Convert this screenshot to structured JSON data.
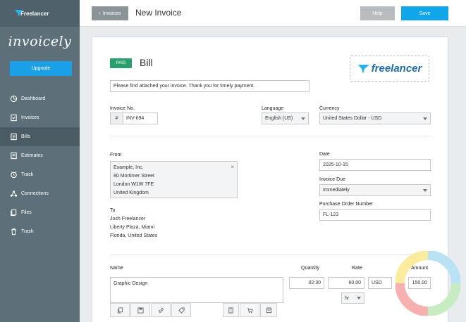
{
  "brand": {
    "name": "Freelancer"
  },
  "sidebar": {
    "logo": "invoicely",
    "upgrade_label": "Upgrade",
    "items": [
      {
        "label": "Dashboard",
        "icon": "dashboard-icon"
      },
      {
        "label": "Invoices",
        "icon": "invoice-icon"
      },
      {
        "label": "Bills",
        "icon": "bill-icon",
        "active": true
      },
      {
        "label": "Estimates",
        "icon": "estimate-icon"
      },
      {
        "label": "Track",
        "icon": "alarm-clock-icon"
      },
      {
        "label": "Connections",
        "icon": "connections-icon"
      },
      {
        "label": "Files",
        "icon": "files-icon"
      },
      {
        "label": "Trash",
        "icon": "trash-icon"
      }
    ]
  },
  "header": {
    "back_label": "Invoices",
    "title": "New Invoice",
    "help_label": "Help",
    "save_label": "Save"
  },
  "doc": {
    "status": "PAID",
    "type": "Bill",
    "logo_text": "freelancer",
    "message": "Please find attached your invoice. Thank you for timely payment.",
    "invoice_no_label": "Invoice No.",
    "invoice_prefix": "#",
    "invoice_no": "INV-694",
    "language_label": "Language",
    "language": "English (US)",
    "currency_label": "Currency",
    "currency": "United States Dollar - USD",
    "from_label": "From",
    "from_lines": [
      "Example, Inc.",
      "80 Mortimer Street",
      "London W1W 7FE",
      "United Kingdom"
    ],
    "to_label": "To",
    "to_lines": [
      "Josh Freelancer",
      "Liberty Plaza, Miami",
      "Florida, United States"
    ],
    "date_label": "Date",
    "date": "2025-10-15",
    "due_label": "Invoice Due",
    "due": "Immediately",
    "po_label": "Purchase Order Number",
    "po": "FL-123",
    "items_header": {
      "name": "Name",
      "quantity": "Quantity",
      "rate": "Rate",
      "amount": "Amount"
    },
    "item": {
      "name": "Graphic Design",
      "quantity": "02:30",
      "rate": "60.00",
      "currency": "USD",
      "amount": "150.00",
      "unit": "hr"
    }
  },
  "colors": {
    "accent": "#11a5ea",
    "sidebar": "#5d6f79",
    "paid": "#2a9e6d"
  }
}
